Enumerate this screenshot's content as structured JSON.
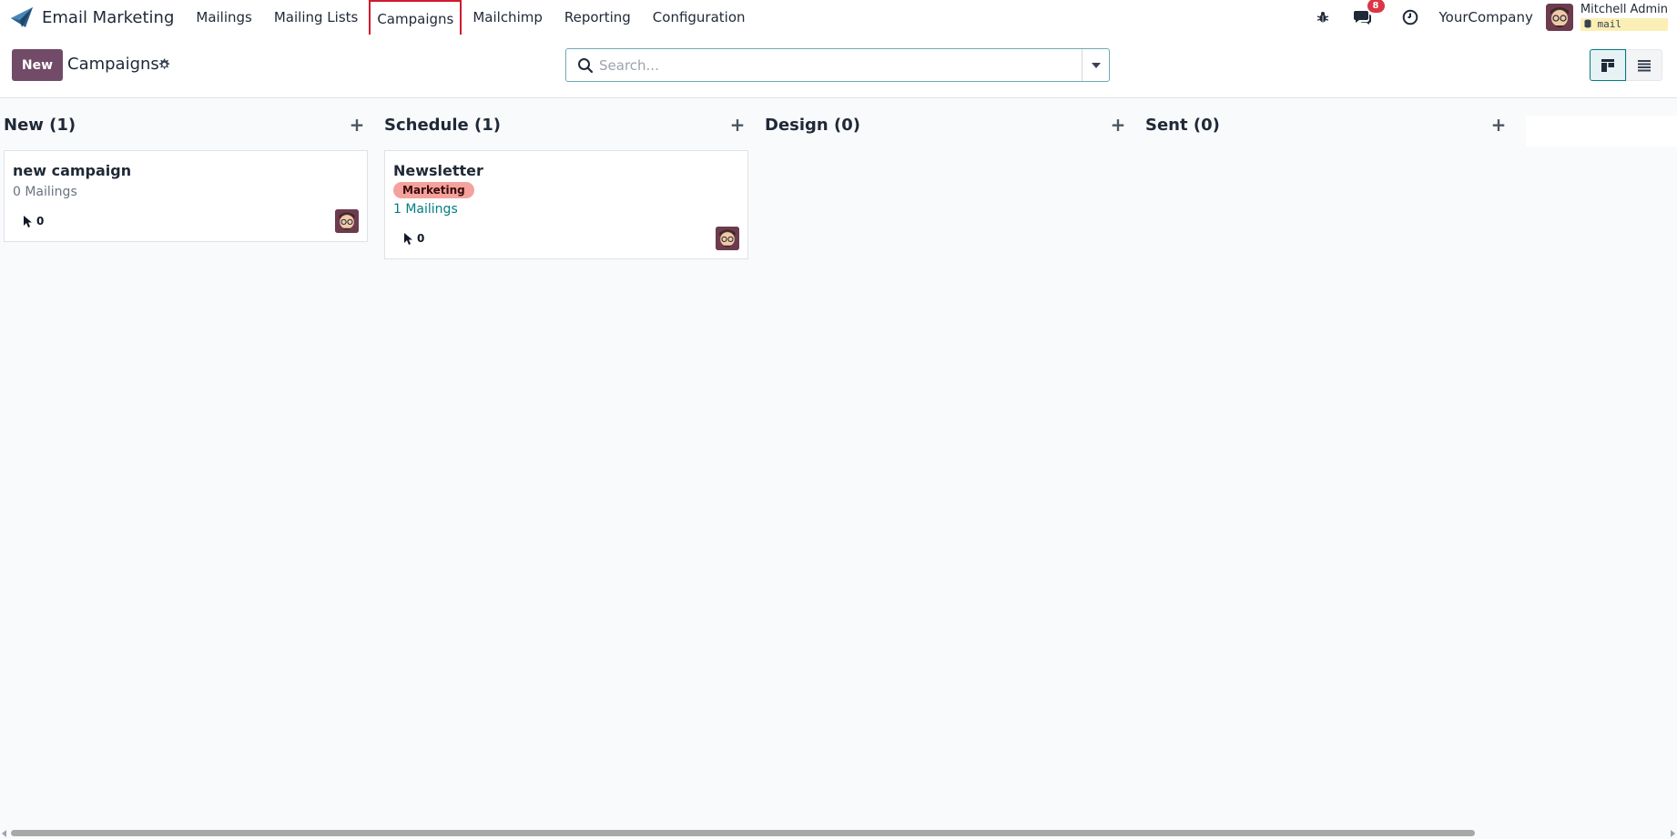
{
  "navbar": {
    "app_name": "Email Marketing",
    "menu": [
      {
        "label": "Mailings"
      },
      {
        "label": "Mailing Lists"
      },
      {
        "label": "Campaigns"
      },
      {
        "label": "Mailchimp"
      },
      {
        "label": "Reporting"
      },
      {
        "label": "Configuration"
      }
    ],
    "messages_count": "8",
    "company": "YourCompany",
    "user_name": "Mitchell Admin",
    "db_name": "mail"
  },
  "control": {
    "new_label": "New",
    "title": "Campaigns",
    "search_placeholder": "Search..."
  },
  "kanban": {
    "columns": [
      {
        "title": "New (1)",
        "cards": [
          {
            "title": "new campaign",
            "mailings": "0 Mailings",
            "clicks": "0"
          }
        ]
      },
      {
        "title": "Schedule (1)",
        "cards": [
          {
            "title": "Newsletter",
            "tag": "Marketing",
            "mailings": "1 Mailings",
            "clicks": "0"
          }
        ]
      },
      {
        "title": "Design (0)",
        "cards": []
      },
      {
        "title": "Sent (0)",
        "cards": []
      }
    ]
  },
  "colors": {
    "primary": "#714b67",
    "accent": "#017e84",
    "tag_marketing": "#f4a29e",
    "badge": "#dc3545",
    "highlight": "#d1192e"
  }
}
